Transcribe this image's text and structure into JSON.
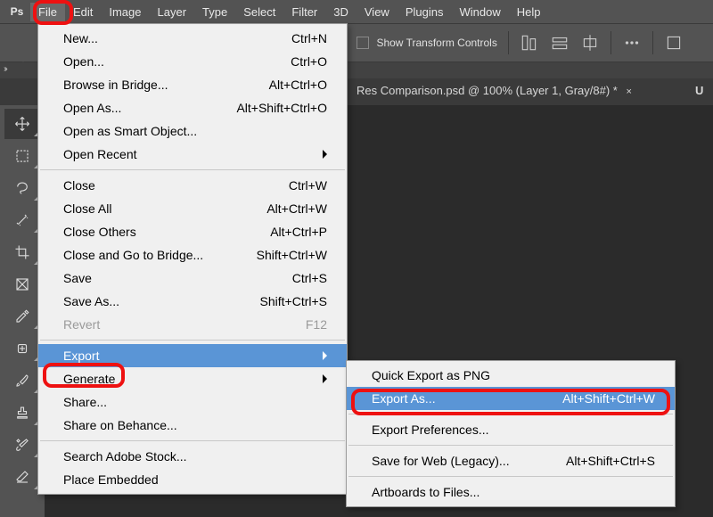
{
  "app": {
    "logo": "Ps"
  },
  "menubar": {
    "items": [
      "File",
      "Edit",
      "Image",
      "Layer",
      "Type",
      "Select",
      "Filter",
      "3D",
      "View",
      "Plugins",
      "Window",
      "Help"
    ],
    "open_index": 0
  },
  "optionsbar": {
    "show_controls_label": "Show Transform Controls"
  },
  "document_tab": {
    "title": "Res Comparison.psd @ 100% (Layer 1, Gray/8#) *",
    "next_partial": "U"
  },
  "file_menu": {
    "groups": [
      [
        {
          "label": "New...",
          "shortcut": "Ctrl+N"
        },
        {
          "label": "Open...",
          "shortcut": "Ctrl+O"
        },
        {
          "label": "Browse in Bridge...",
          "shortcut": "Alt+Ctrl+O"
        },
        {
          "label": "Open As...",
          "shortcut": "Alt+Shift+Ctrl+O"
        },
        {
          "label": "Open as Smart Object..."
        },
        {
          "label": "Open Recent",
          "submenu": true
        }
      ],
      [
        {
          "label": "Close",
          "shortcut": "Ctrl+W"
        },
        {
          "label": "Close All",
          "shortcut": "Alt+Ctrl+W"
        },
        {
          "label": "Close Others",
          "shortcut": "Alt+Ctrl+P"
        },
        {
          "label": "Close and Go to Bridge...",
          "shortcut": "Shift+Ctrl+W"
        },
        {
          "label": "Save",
          "shortcut": "Ctrl+S"
        },
        {
          "label": "Save As...",
          "shortcut": "Shift+Ctrl+S"
        },
        {
          "label": "Revert",
          "shortcut": "F12",
          "disabled": true
        }
      ],
      [
        {
          "label": "Export",
          "submenu": true,
          "hover": true
        },
        {
          "label": "Generate",
          "submenu": true
        },
        {
          "label": "Share..."
        },
        {
          "label": "Share on Behance..."
        }
      ],
      [
        {
          "label": "Search Adobe Stock..."
        },
        {
          "label": "Place Embedded"
        }
      ]
    ]
  },
  "export_submenu": {
    "groups": [
      [
        {
          "label": "Quick Export as PNG"
        },
        {
          "label": "Export As...",
          "shortcut": "Alt+Shift+Ctrl+W",
          "hover": true
        }
      ],
      [
        {
          "label": "Export Preferences..."
        }
      ],
      [
        {
          "label": "Save for Web (Legacy)...",
          "shortcut": "Alt+Shift+Ctrl+S"
        }
      ],
      [
        {
          "label": "Artboards to Files..."
        }
      ]
    ]
  },
  "tools": [
    {
      "name": "move-tool",
      "active": true
    },
    {
      "name": "marquee-tool"
    },
    {
      "name": "lasso-tool"
    },
    {
      "name": "wand-tool"
    },
    {
      "name": "crop-tool"
    },
    {
      "name": "frame-tool"
    },
    {
      "name": "eyedropper-tool"
    },
    {
      "name": "healing-tool"
    },
    {
      "name": "brush-tool"
    },
    {
      "name": "stamp-tool"
    },
    {
      "name": "history-brush-tool"
    },
    {
      "name": "eraser-tool"
    }
  ]
}
